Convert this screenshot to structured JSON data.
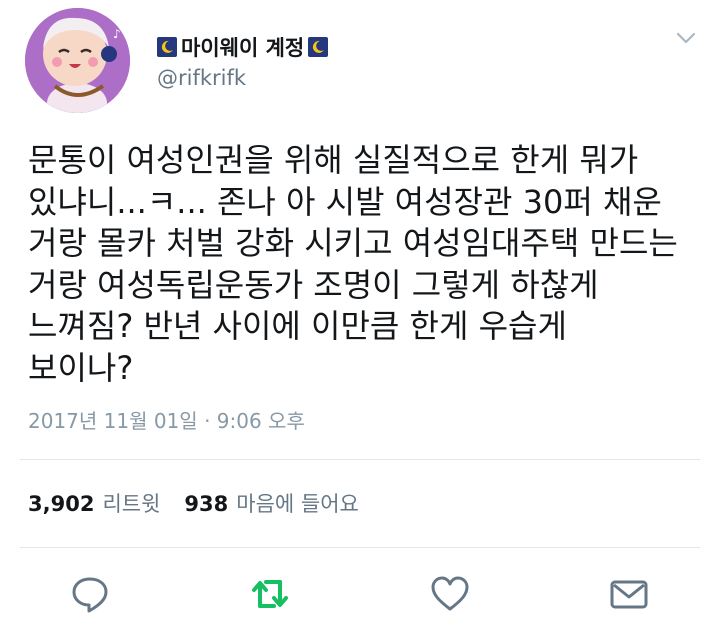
{
  "tweet": {
    "display_name": "마이웨이 계정",
    "handle": "@rifkrifk",
    "text_lines": [
      "문통이 여성인권을 위해 실질적으로 한게 뭐가",
      "있냐니...ㅋ... 존나 아 시발 여성장관 30퍼 채운",
      "거랑 몰카 처벌 강화 시키고 여성임대주택 만드는",
      "거랑 여성독립운동가 조명이 그렇게 하찮게",
      "느껴짐? 반년 사이에 이만큼 한게 우습게",
      "보이나?"
    ],
    "timestamp": "2017년 11월 01일 · 9:06 오후",
    "retweet_count": "3,902",
    "retweet_label": "리트윗",
    "like_count": "938",
    "like_label": "마음에 들어요"
  },
  "icons": {
    "name_badge": "crescent-moon-icon",
    "menu": "chevron-down-icon",
    "reply": "reply-icon",
    "retweet": "retweet-icon",
    "like": "heart-icon",
    "message": "envelope-icon"
  },
  "colors": {
    "text": "#14171a",
    "secondary": "#657786",
    "timestamp": "#8899a6",
    "retweet_active": "#17bf63",
    "action_gray": "#657786",
    "avatar_bg": "#ad6ec8",
    "badge_bg": "#25377d",
    "moon": "#f5c518"
  }
}
